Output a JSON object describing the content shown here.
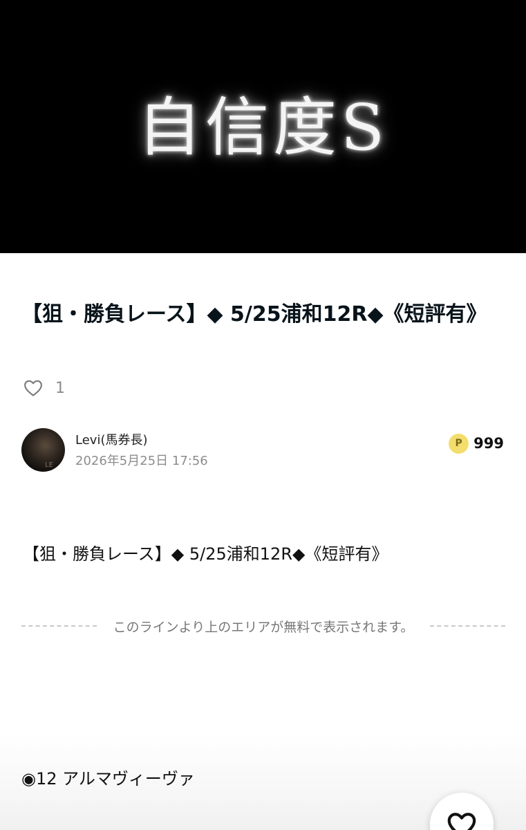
{
  "hero": {
    "text": "自信度S"
  },
  "post": {
    "title": "【狙・勝負レース】◆ 5/25浦和12R◆《短評有》",
    "like_count": "1"
  },
  "author": {
    "name": "Levi(馬券長)",
    "date": "2026年5月25日 17:56",
    "avatar_mark": "LE"
  },
  "points": {
    "icon_letter": "P",
    "value": "999"
  },
  "body": {
    "first_line": "【狙・勝負レース】◆ 5/25浦和12R◆《短評有》",
    "free_area_notice": "このラインより上のエリアが無料で表示されます。",
    "locked_line": "◉12 アルマヴィーヴァ"
  },
  "colors": {
    "accent_yellow": "#f3de6d",
    "hero_bg": "#000000",
    "title_text": "#08131a"
  },
  "icons": {
    "like": "heart-outline-icon",
    "points": "points-coin-icon",
    "fab": "heart-outline-icon"
  }
}
